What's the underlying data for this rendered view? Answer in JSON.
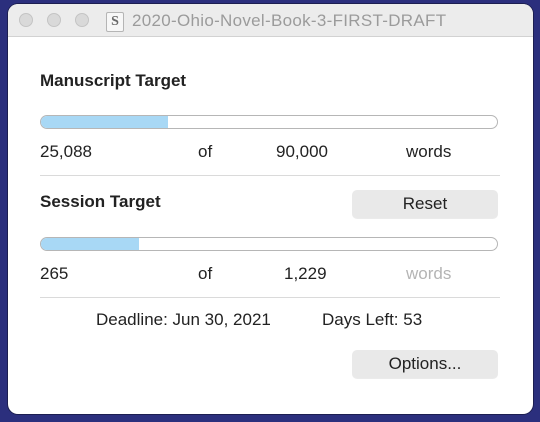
{
  "window": {
    "title": "2020-Ohio-Novel-Book-3-FIRST-DRAFT",
    "doc_icon_letter": "S"
  },
  "manuscript": {
    "heading": "Manuscript Target",
    "progress_fraction": 0.279,
    "current": "25,088",
    "of_label": "of",
    "target": "90,000",
    "unit": "words"
  },
  "session": {
    "heading": "Session Target",
    "reset_label": "Reset",
    "progress_fraction": 0.216,
    "current": "265",
    "of_label": "of",
    "target": "1,229",
    "unit": "words"
  },
  "deadline": {
    "label": "Deadline: Jun 30, 2021",
    "days_left": "Days Left: 53"
  },
  "options_label": "Options...",
  "colors": {
    "progress_fill": "#a8d8f5",
    "background": "#2b2f7d"
  }
}
